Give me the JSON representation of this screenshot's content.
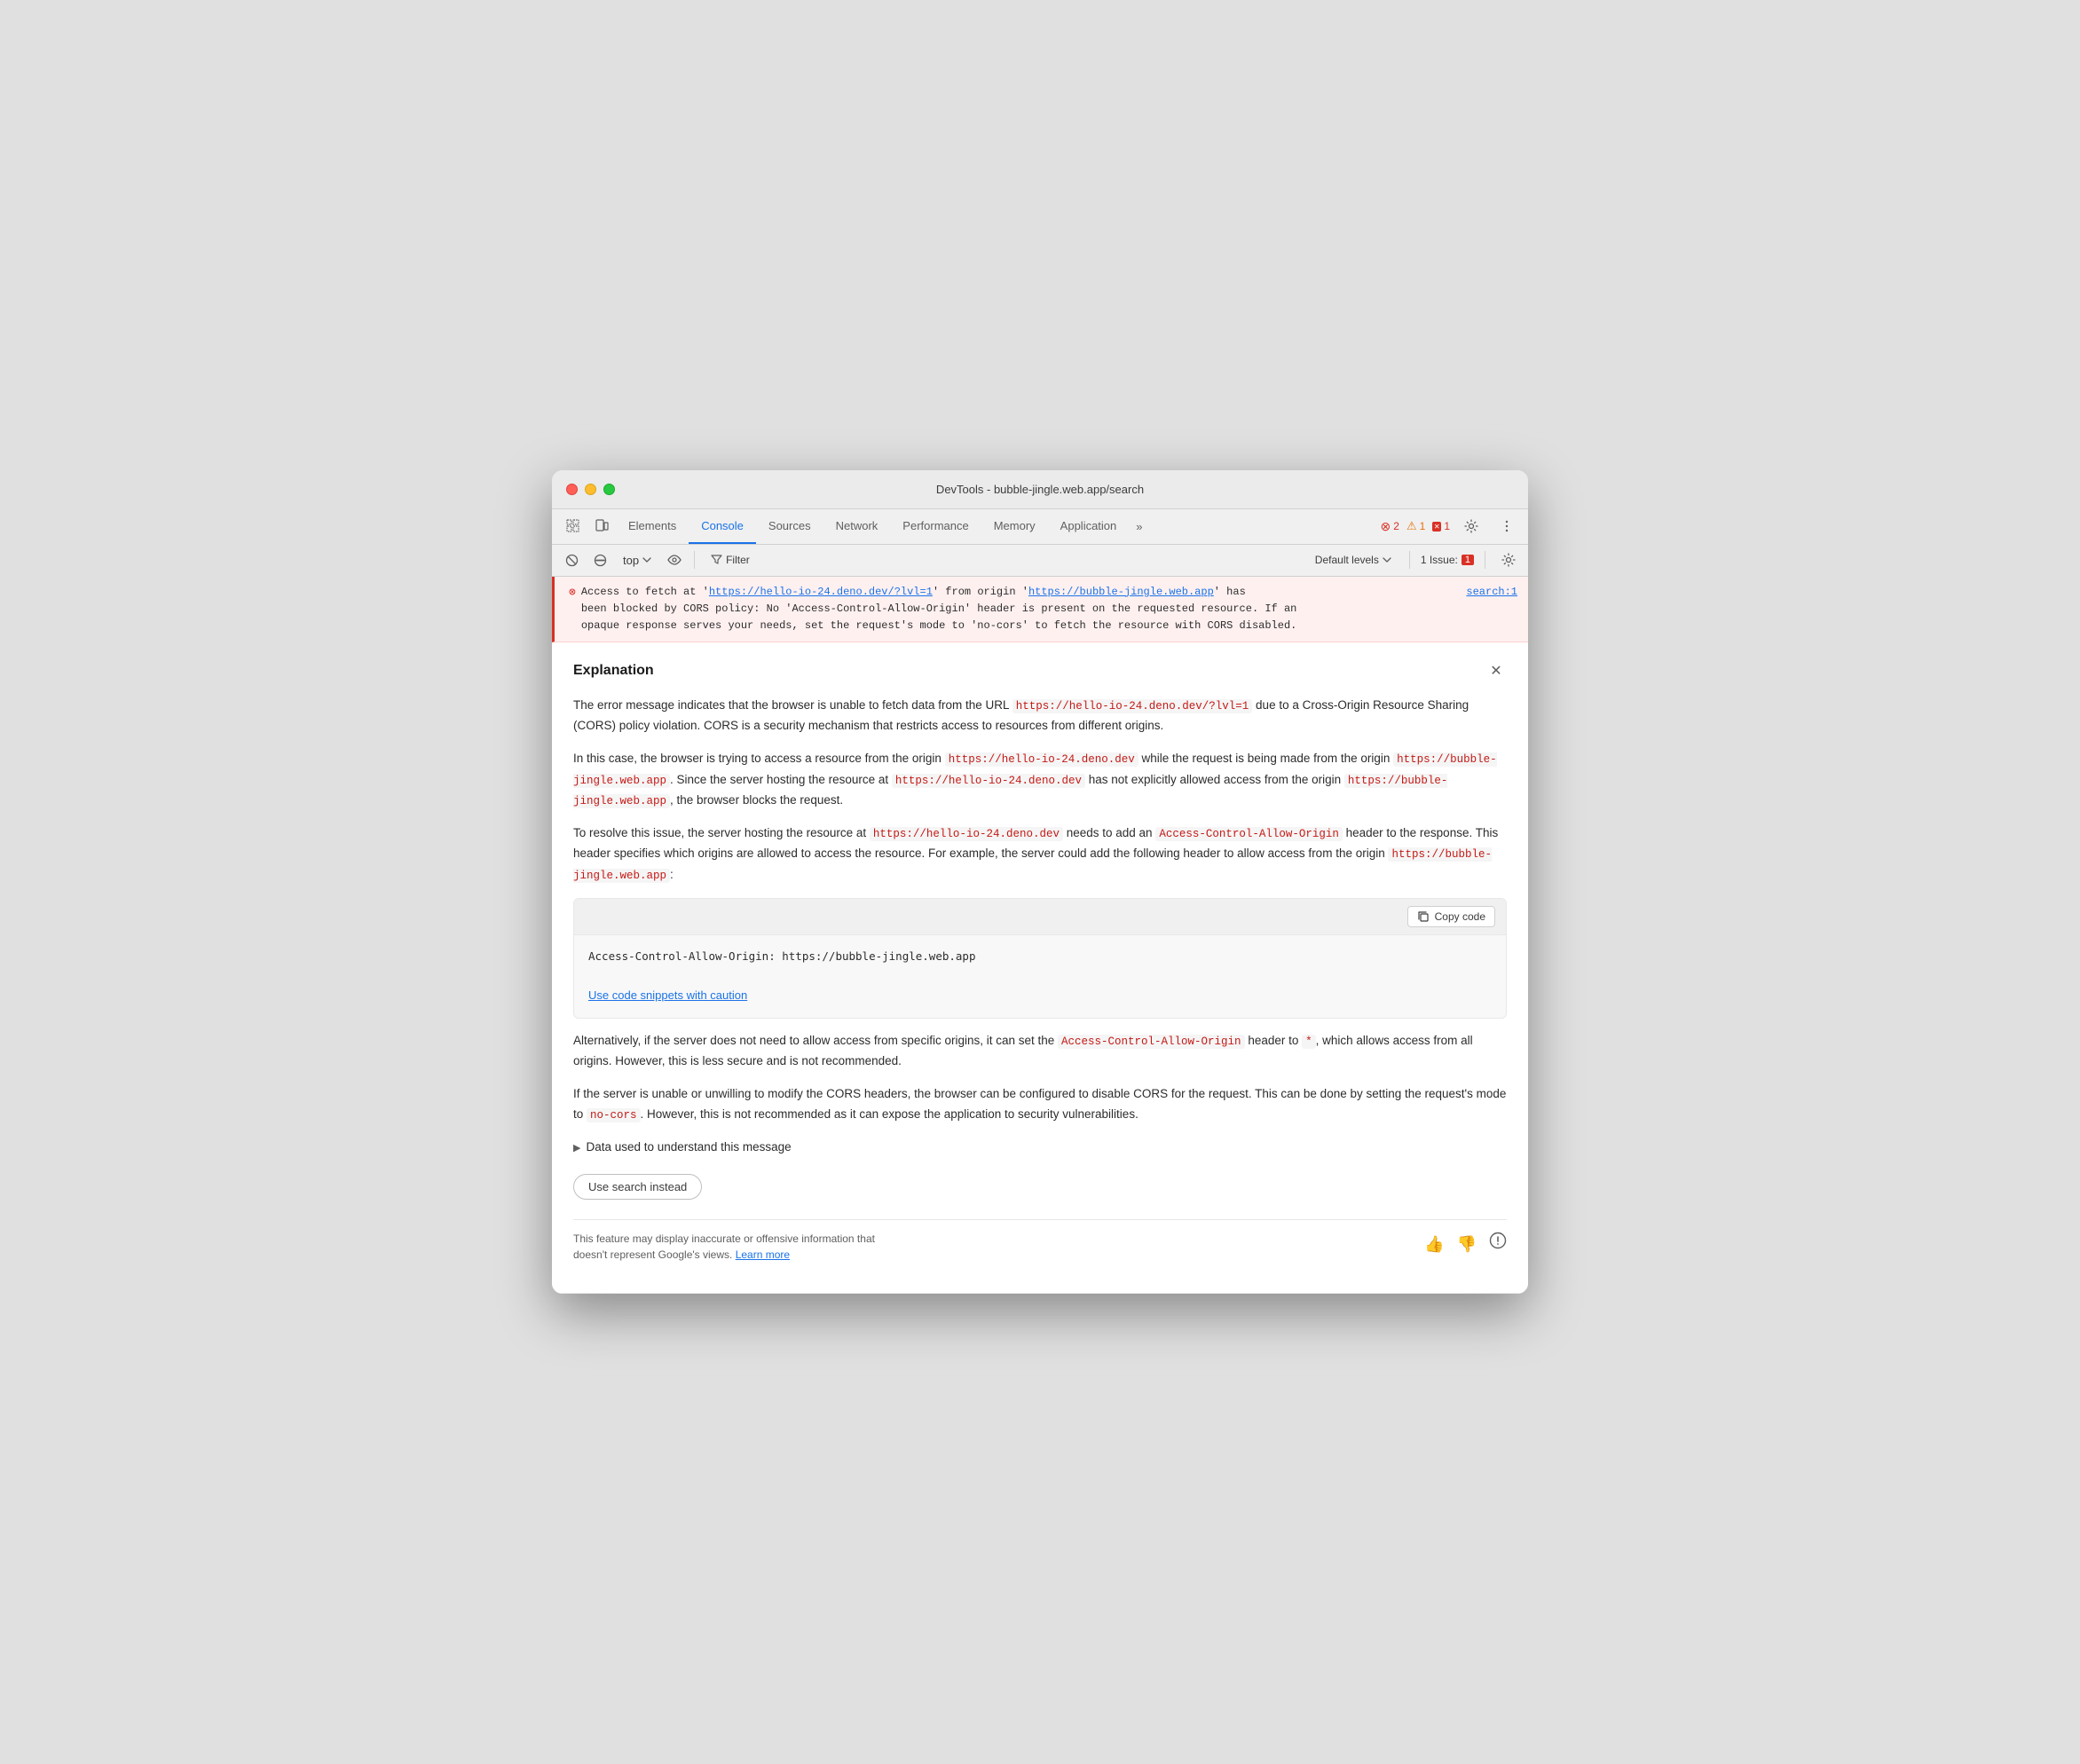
{
  "window": {
    "title": "DevTools - bubble-jingle.web.app/search"
  },
  "tabs": {
    "items": [
      {
        "id": "elements",
        "label": "Elements",
        "active": false
      },
      {
        "id": "console",
        "label": "Console",
        "active": true
      },
      {
        "id": "sources",
        "label": "Sources",
        "active": false
      },
      {
        "id": "network",
        "label": "Network",
        "active": false
      },
      {
        "id": "performance",
        "label": "Performance",
        "active": false
      },
      {
        "id": "memory",
        "label": "Memory",
        "active": false
      },
      {
        "id": "application",
        "label": "Application",
        "active": false
      }
    ],
    "more_label": "»",
    "error_count": "2",
    "warning_count": "1",
    "info_count": "1"
  },
  "toolbar": {
    "context_label": "top",
    "filter_label": "Filter",
    "default_levels_label": "Default levels",
    "issue_label": "1 Issue:",
    "issue_count": "1"
  },
  "error_message": {
    "prefix": "Access to fetch at '",
    "url1": "https://hello-io-24.deno.dev/?lvl=1",
    "middle1": "' from origin '",
    "url2": "https://bubble-jingle.web.app",
    "suffix": "' has",
    "line2": "been blocked by CORS policy: No 'Access-Control-Allow-Origin' header is present on the requested resource. If an",
    "line3": "opaque response serves your needs, set the request's mode to 'no-cors' to fetch the resource with CORS disabled.",
    "source_link": "search:1"
  },
  "explanation": {
    "title": "Explanation",
    "body_p1": "The error message indicates that the browser is unable to fetch data from the URL ",
    "body_p1_code": "https://hello-io-24.deno.dev/?lvl=1",
    "body_p1_suffix": " due to a Cross-Origin Resource Sharing (CORS) policy violation. CORS is a security mechanism that restricts access to resources from different origins.",
    "body_p2_prefix": "In this case, the browser is trying to access a resource from the origin ",
    "body_p2_code1": "https://hello-io-24.deno.dev",
    "body_p2_middle1": " while the request is being made from the origin ",
    "body_p2_code2": "https://bubble-jingle.web.app",
    "body_p2_middle2": ". Since the server hosting the resource at ",
    "body_p2_code3": "https://hello-io-24.deno.dev",
    "body_p2_middle3": " has not explicitly allowed access from the origin ",
    "body_p2_code4": "https://bubble-jingle.web.app",
    "body_p2_suffix": ", the browser blocks the request.",
    "body_p3_prefix": "To resolve this issue, the server hosting the resource at ",
    "body_p3_code1": "https://hello-io-24.deno.dev",
    "body_p3_middle1": " needs to add an ",
    "body_p3_code2": "Access-Control-Allow-Origin",
    "body_p3_middle2": " header to the response. This header specifies which origins are allowed to access the resource. For example, the server could add the following header to allow access from the origin ",
    "body_p3_code3": "https://bubble-jingle.web.app",
    "body_p3_suffix": ":",
    "copy_code_label": "Copy code",
    "code_snippet": "Access-Control-Allow-Origin: https://bubble-jingle.web.app",
    "caution_link": "Use code snippets with caution",
    "body_p4": "Alternatively, if the server does not need to allow access from specific origins, it can set the ",
    "body_p4_code1": "Access-Control-Allow-Origin",
    "body_p4_middle": " header to ",
    "body_p4_code2": "*",
    "body_p4_suffix": ", which allows access from all origins. However, this is less secure and is not recommended.",
    "body_p5": "If the server is unable or unwilling to modify the CORS headers, the browser can be configured to disable CORS for the request. This can be done by setting the request's mode to ",
    "body_p5_code": "no-cors",
    "body_p5_suffix": ". However, this is not recommended as it can expose the application to security vulnerabilities.",
    "data_used_label": "Data used to understand this message",
    "use_search_label": "Use search instead",
    "disclaimer": "This feature may display inaccurate or offensive information that doesn't represent Google's views.",
    "learn_more": "Learn more"
  }
}
